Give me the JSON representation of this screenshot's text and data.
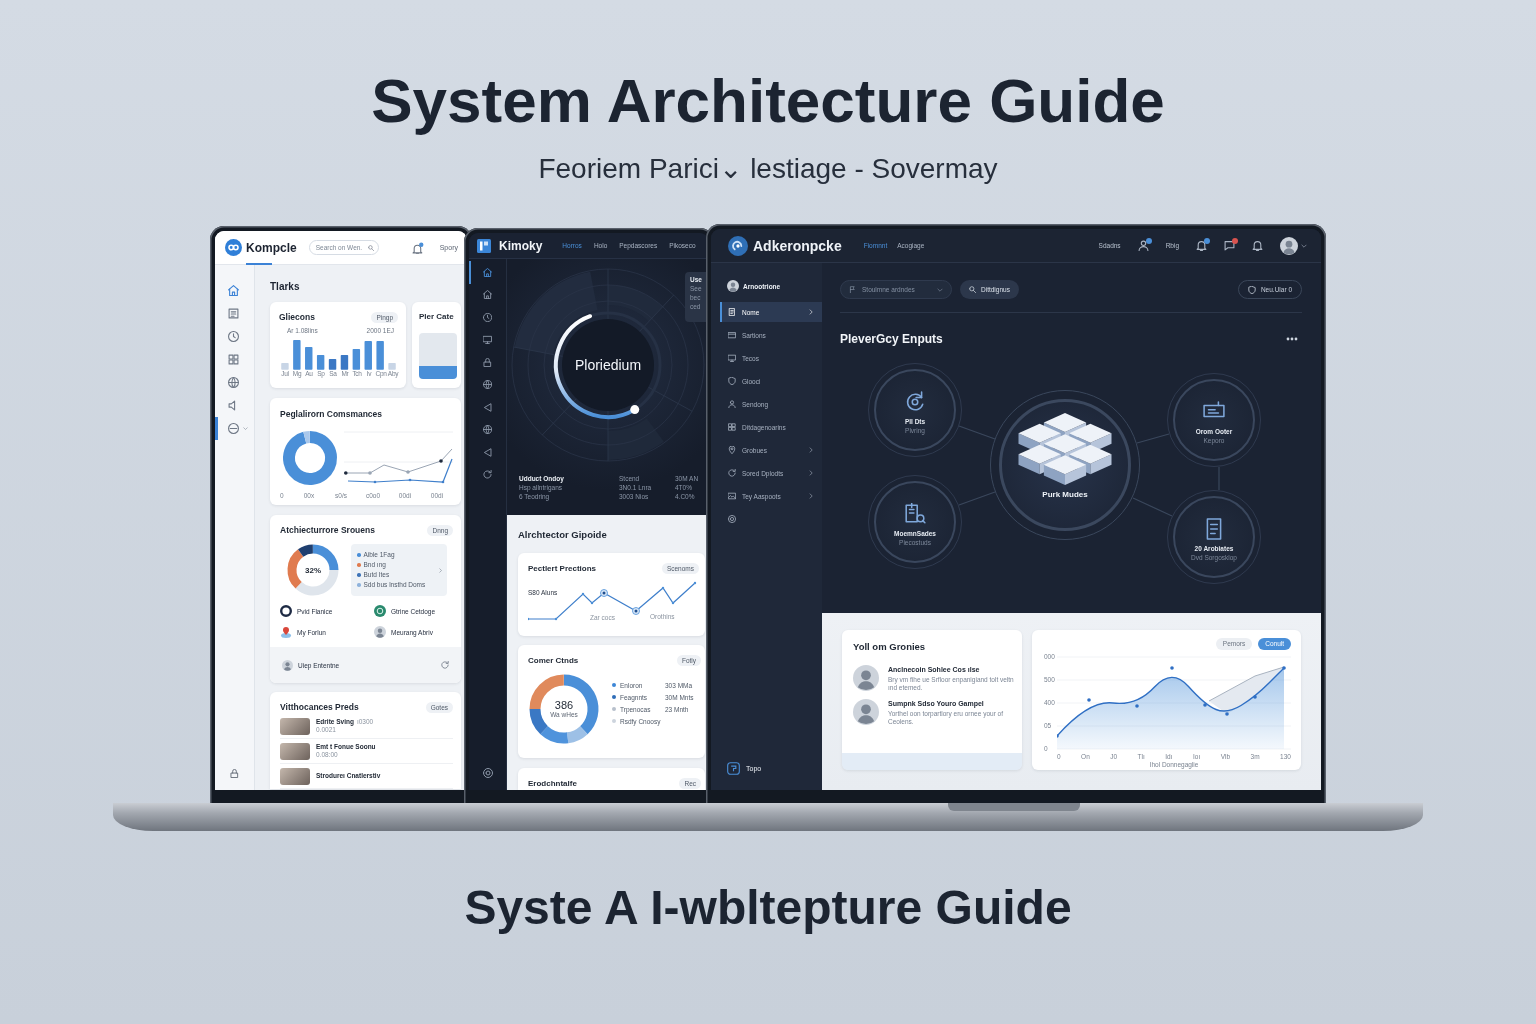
{
  "title": "System Architecture Guide",
  "subtitle": "Feoriem Parici⌄ lestiage - Sovermay",
  "footer_title": "Syste A I-wbltepture Guide",
  "left_screen": {
    "header": {
      "brand": "Kompcle",
      "search": {
        "placeholder": "Search on Wen."
      },
      "notification": true,
      "user": "Spory"
    },
    "sidebar": {
      "items": [
        {
          "selected": true,
          "expanded": false
        },
        {
          "selected": false,
          "expanded": false
        },
        {
          "selected": false,
          "expanded": false
        },
        {
          "selected": false,
          "expanded": false
        },
        {
          "selected": false,
          "expanded": false
        },
        {
          "selected": false,
          "expanded": false
        },
        {
          "selected": false,
          "expanded": true
        }
      ]
    },
    "page_title": "Tlarks",
    "bar_card": {
      "title": "Gliecons",
      "button": "Pingp",
      "notes": [
        "Ar 1.08lins",
        "2000 1EJ"
      ],
      "x_labels": [
        "Jul",
        "Mg",
        "Au",
        "Sp",
        "Sa",
        "Mr",
        "Tch",
        "Iv",
        "Cpn",
        "Aby"
      ]
    },
    "map_card": {
      "title": "Pler Cate"
    },
    "performance_card": {
      "title": "Peglalirorn Comsmances",
      "y_label": "0",
      "x_labels": [
        "00x",
        "s0/s",
        "c0o0",
        "00di",
        "00di"
      ]
    },
    "structure_card": {
      "title": "Atchiecturrore Srouens",
      "button": "Dnng",
      "donut_label": "32%",
      "legend": [
        {
          "label": "Aible 1Fag",
          "color": "#4a8fd8"
        },
        {
          "label": "Bnd ıng",
          "color": "#e07b4f"
        },
        {
          "label": "Butd Ites",
          "color": "#3f74b8"
        },
        {
          "label": "Sdd bus lnsthd Doms",
          "color": "#8fb3dc"
        }
      ],
      "people": [
        {
          "name": "Pvid Flanice",
          "kind": "ring"
        },
        {
          "name": "Gtrine Cetdoge",
          "kind": "disc"
        },
        {
          "name": "My Forlun",
          "kind": "pin"
        },
        {
          "name": "Meurang Abriv",
          "kind": "photo"
        }
      ],
      "footer": "Uiep Ententne"
    },
    "videos_card": {
      "title": "Vitthocances Preds",
      "button": "Gotes",
      "items": [
        {
          "title": "Edrite Sving",
          "meta": "ı0300",
          "sub": "0.0021"
        },
        {
          "title": "Emt t Fonue Soonu",
          "sub": "0.08:00"
        },
        {
          "title": "Strodureı Cnatlerstiv"
        }
      ]
    }
  },
  "middle_screen": {
    "header": {
      "brand": "Kimoky",
      "nav": [
        {
          "label": "Horros",
          "selected": true
        },
        {
          "label": "Holo",
          "selected": false
        },
        {
          "label": "Pepdascores",
          "selected": false
        },
        {
          "label": "Pikoseco",
          "selected": false
        }
      ]
    },
    "sidebar": {
      "items": [
        {
          "selected": true
        },
        {
          "selected": false
        },
        {
          "selected": false
        },
        {
          "selected": false
        },
        {
          "selected": false
        },
        {
          "selected": false
        },
        {
          "selected": false
        },
        {
          "selected": false
        },
        {
          "selected": false
        },
        {
          "selected": false
        }
      ]
    },
    "hero": {
      "title": "Ploriedium",
      "tooltip": {
        "title": "Use",
        "lines": [
          "See",
          "bec",
          "ced"
        ]
      },
      "stats": [
        {
          "lines": [
            "Udduct Ondoy",
            "Hsp allntrigans",
            "6 Teodring"
          ]
        },
        {
          "lines": [
            "Stcend",
            "3N0.1 Lnra",
            "3003 Nios"
          ]
        },
        {
          "lines": [
            "30M AN",
            "4T0%",
            "4.C0%"
          ]
        }
      ]
    },
    "section_title": "Alrchtector Gipoide",
    "line_card": {
      "title": "Pectlert Prections",
      "button": "Scenoms",
      "value": "S80 Aluns",
      "notes": [
        "Zar cocs",
        "Orothins"
      ]
    },
    "donut_card": {
      "title": "Comer Ctnds",
      "button": "Fotly",
      "center_value": "386",
      "center_label": "Wa wHes",
      "legend": [
        {
          "label": "Enloron",
          "value": "303 MMa",
          "color": "#3d86d6"
        },
        {
          "label": "Feagnnts",
          "value": "30M Mnts",
          "color": "#2f6db8"
        },
        {
          "label": "Trpenocas",
          "value": "23 Mnth",
          "color": "#b7c0cc"
        },
        {
          "label": "Rsdfy Cnoosy",
          "color": "#cdd4dd"
        }
      ]
    },
    "partial_card": {
      "title": "Erodchntalfe",
      "button": "Rec"
    }
  },
  "right_screen": {
    "header": {
      "brand": "Adkeronpcke",
      "nav": [
        {
          "label": "Fiomnnt",
          "selected": true
        },
        {
          "label": "Acogiage",
          "selected": false
        }
      ],
      "tools": [
        {
          "kind": "link",
          "label": "Sdadns"
        },
        {
          "kind": "icon",
          "badge": true,
          "color": "#4a8fd8"
        },
        {
          "kind": "link",
          "label": "Rbig"
        },
        {
          "kind": "icon",
          "badge": true,
          "color": "#4a8fd8"
        },
        {
          "kind": "icon",
          "badge": true,
          "color": "#d9534f"
        },
        {
          "kind": "icon",
          "badge": false
        }
      ]
    },
    "sidebar": {
      "profile": "Arnootrione",
      "items": [
        {
          "label": "Nome",
          "selected": true,
          "submenu": true
        },
        {
          "label": "Sartions",
          "selected": false,
          "submenu": false
        },
        {
          "label": "Tecos",
          "selected": false,
          "submenu": false
        },
        {
          "label": "Glooci",
          "selected": false,
          "submenu": false
        },
        {
          "label": "Sendong",
          "selected": false,
          "submenu": false
        },
        {
          "label": "Ditdagenoarins",
          "selected": false,
          "submenu": false
        },
        {
          "label": "Grobues",
          "selected": false,
          "submenu": true
        },
        {
          "label": "Sored Dplodts",
          "selected": false,
          "submenu": true
        },
        {
          "label": "Tey Aaspoots",
          "selected": false,
          "submenu": true
        },
        {
          "selected": false,
          "submenu": false
        }
      ],
      "footer": "Topo"
    },
    "toolbar": {
      "filter": "Stoulmne ardndes",
      "search_button": "Dittdignus",
      "action_button": "Neu.Ular 0"
    },
    "section_title": "PleverGcy Enputs",
    "diagram": {
      "center": "Purk Mudes",
      "nodes": [
        {
          "label": "Pll Dts",
          "caption": "Plvring"
        },
        {
          "label": "Orom Ooter",
          "caption": "Keporo"
        },
        {
          "label": "MoemnSades",
          "caption": "Piecostuds"
        },
        {
          "label": "20 Arobiates",
          "caption": "Dvd Sorgosklop"
        }
      ]
    },
    "testimonials": {
      "title": "Yoll om Gronies",
      "items": [
        {
          "name": "Anclnecoin Sohlee Cos ılse",
          "text": "Bry vm fihe ue Srfloor enpanigiand tolt veltn ınd etemed."
        },
        {
          "name": "Sumpnk Sdso Youro Gampel",
          "text": "Yorthel oon torpartlory eru ornee your of Ceolens."
        }
      ]
    },
    "chart_card": {
      "tabs": [
        {
          "label": "Pemors",
          "selected": false
        },
        {
          "label": "Conult",
          "selected": true
        }
      ],
      "y_labels": [
        "000",
        "500",
        "400",
        "05",
        "0"
      ],
      "x_labels": [
        "0",
        "On",
        "J0",
        "Tlı",
        "Idı",
        "Ioı",
        "Vlb",
        "3m",
        "130"
      ],
      "x_title": "Ihol Donnegaglie"
    }
  }
}
